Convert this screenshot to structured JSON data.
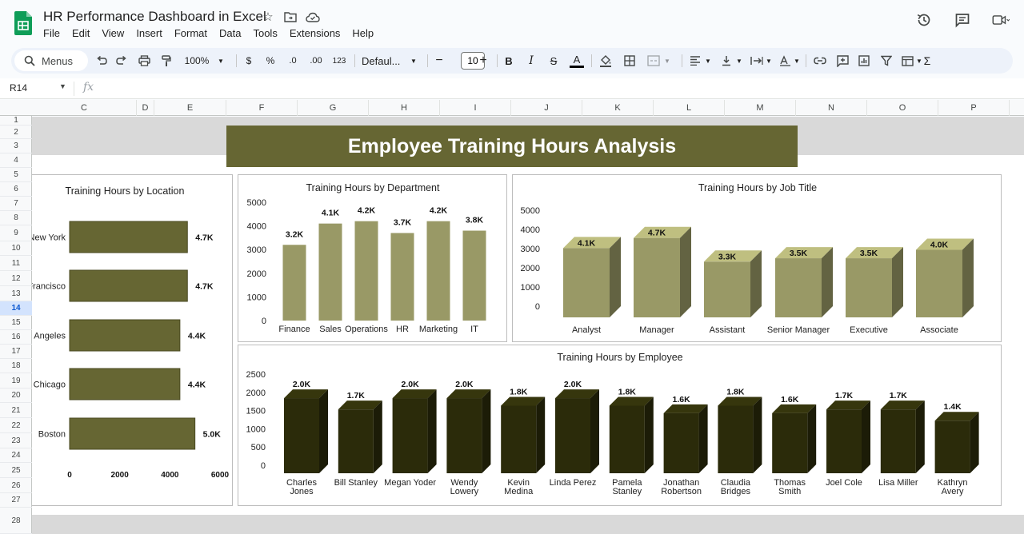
{
  "app": {
    "title": "HR Performance Dashboard in Excel",
    "menu": [
      "File",
      "Edit",
      "View",
      "Insert",
      "Format",
      "Data",
      "Tools",
      "Extensions",
      "Help"
    ]
  },
  "toolbar": {
    "search_label": "Menus",
    "zoom": "100%",
    "currency": "$",
    "percent": "%",
    "dec_decrease": ".0",
    "dec_increase": ".00",
    "number_format": "123",
    "font": "Defaul...",
    "font_size": "10",
    "bold": "B",
    "italic": "I",
    "strike": "S",
    "text_color": "A",
    "sum": "Σ"
  },
  "formula_bar": {
    "cell_ref": "R14",
    "fx": "fx",
    "value": ""
  },
  "grid": {
    "columns": [
      "C",
      "D",
      "E",
      "F",
      "G",
      "H",
      "I",
      "J",
      "K",
      "L",
      "M",
      "N",
      "O",
      "P"
    ],
    "rows": [
      "1",
      "2",
      "3",
      "4",
      "5",
      "6",
      "7",
      "8",
      "9",
      "10",
      "11",
      "12",
      "13",
      "14",
      "15",
      "16",
      "17",
      "18",
      "19",
      "20",
      "21",
      "22",
      "23",
      "24",
      "25",
      "26",
      "27",
      "28"
    ],
    "selected_row": "14"
  },
  "dashboard": {
    "banner": "Employee Training Hours Analysis",
    "colors": {
      "olive_dark": "#666633",
      "olive_light": "#999966",
      "bar_dark": "#2b2b0a"
    }
  },
  "chart_data": [
    {
      "id": "location",
      "type": "bar",
      "orientation": "horizontal",
      "title": "Training Hours by Location",
      "categories": [
        "New York",
        "Francisco",
        "Angeles",
        "Chicago",
        "Boston"
      ],
      "values": [
        4700,
        4700,
        4400,
        4400,
        5000
      ],
      "data_labels": [
        "4.7K",
        "4.7K",
        "4.4K",
        "4.4K",
        "5.0K"
      ],
      "xlim": [
        0,
        6000
      ],
      "x_ticks": [
        "0",
        "2000",
        "4000",
        "6000"
      ],
      "grid": false,
      "legend": "none"
    },
    {
      "id": "department",
      "type": "bar",
      "title": "Training Hours by Department",
      "categories": [
        "Finance",
        "Sales",
        "Operations",
        "HR",
        "Marketing",
        "IT"
      ],
      "values": [
        3200,
        4100,
        4200,
        3700,
        4200,
        3800
      ],
      "data_labels": [
        "3.2K",
        "4.1K",
        "4.2K",
        "3.7K",
        "4.2K",
        "3.8K"
      ],
      "ylim": [
        0,
        5000
      ],
      "y_ticks": [
        "0",
        "1000",
        "2000",
        "3000",
        "4000",
        "5000"
      ],
      "grid": false,
      "legend": "none"
    },
    {
      "id": "jobtitle",
      "type": "bar",
      "style": "3d",
      "title": "Training Hours by Job Title",
      "categories": [
        "Analyst",
        "Manager",
        "Assistant",
        "Senior Manager",
        "Executive",
        "Associate"
      ],
      "values": [
        4100,
        4700,
        3300,
        3500,
        3500,
        4000
      ],
      "data_labels": [
        "4.1K",
        "4.7K",
        "3.3K",
        "3.5K",
        "3.5K",
        "4.0K"
      ],
      "ylim": [
        0,
        5000
      ],
      "y_ticks": [
        "0",
        "1000",
        "2000",
        "3000",
        "4000",
        "5000"
      ],
      "grid": false,
      "legend": "none"
    },
    {
      "id": "employee",
      "type": "bar",
      "style": "3d",
      "title": "Training Hours by Employee",
      "categories": [
        "Charles Jones",
        "Bill Stanley",
        "Megan Yoder",
        "Wendy Lowery",
        "Kevin Medina",
        "Linda Perez",
        "Pamela Stanley",
        "Jonathan Robertson",
        "Claudia Bridges",
        "Thomas Smith",
        "Joel Cole",
        "Lisa Miller",
        "Kathryn Avery"
      ],
      "category_lines": [
        [
          "Charles",
          "Jones"
        ],
        [
          "Bill Stanley"
        ],
        [
          "Megan Yoder"
        ],
        [
          "Wendy",
          "Lowery"
        ],
        [
          "Kevin",
          "Medina"
        ],
        [
          "Linda Perez"
        ],
        [
          "Pamela",
          "Stanley"
        ],
        [
          "Jonathan",
          "Robertson"
        ],
        [
          "Claudia",
          "Bridges"
        ],
        [
          "Thomas",
          "Smith"
        ],
        [
          "Joel Cole"
        ],
        [
          "Lisa Miller"
        ],
        [
          "Kathryn",
          "Avery"
        ]
      ],
      "values": [
        2000,
        1700,
        2000,
        2000,
        1800,
        2000,
        1800,
        1600,
        1800,
        1600,
        1700,
        1700,
        1400
      ],
      "data_labels": [
        "2.0K",
        "1.7K",
        "2.0K",
        "2.0K",
        "1.8K",
        "2.0K",
        "1.8K",
        "1.6K",
        "1.8K",
        "1.6K",
        "1.7K",
        "1.7K",
        "1.4K"
      ],
      "ylim": [
        0,
        2500
      ],
      "y_ticks": [
        "0",
        "500",
        "1000",
        "1500",
        "2000",
        "2500"
      ],
      "grid": false,
      "legend": "none"
    }
  ]
}
